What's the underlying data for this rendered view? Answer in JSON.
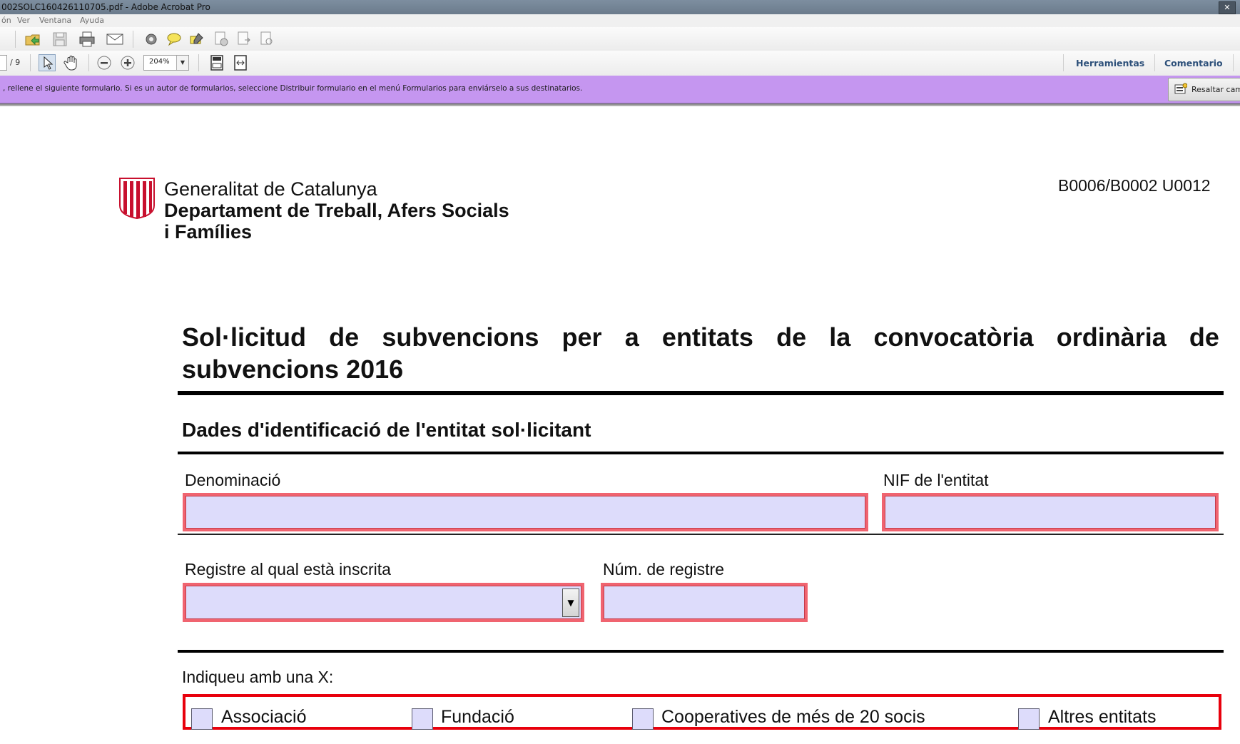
{
  "window": {
    "title": "002SOLC160426110705.pdf - Adobe Acrobat Pro"
  },
  "menu": {
    "items": [
      "ón",
      "Ver",
      "Ventana",
      "Ayuda"
    ]
  },
  "toolbar": {
    "page_total": "/ 9",
    "zoom": "204%",
    "tools_link": "Herramientas",
    "comment_link": "Comentario"
  },
  "form_bar": {
    "message": ", rellene el siguiente formulario. Si es un autor de formularios, seleccione Distribuir formulario en el menú Formularios para enviárselo a sus destinatarios.",
    "highlight_button": "Resaltar cam"
  },
  "document": {
    "org_line1": "Generalitat de Catalunya",
    "org_line2": "Departament de Treball, Afers Socials",
    "org_line3": "i Famílies",
    "reference": "B0006/B0002 U0012",
    "title_words_line1": [
      "Sol·licitud",
      "de",
      "subvencions",
      "per",
      "a",
      "entitats",
      "de",
      "la",
      "convocatòria",
      "ordinària",
      "de"
    ],
    "title_line2": "subvencions 2016",
    "section_title": "Dades d'identificació de l'entitat sol·licitant",
    "fields": {
      "denominacio_label": "Denominació",
      "nif_label": "NIF de l'entitat",
      "registre_label": "Registre al qual està inscrita",
      "num_registre_label": "Núm. de registre",
      "denominacio_value": "",
      "nif_value": "",
      "registre_value": "",
      "num_registre_value": ""
    },
    "indicate_label": "Indiqueu amb una X:",
    "entity_types": [
      "Associació",
      "Fundació",
      "Cooperatives de més de 20 socis",
      "Altres entitats"
    ],
    "colors": {
      "field_fill": "#dddcfb",
      "field_border": "#f06470",
      "group_border": "#e8000c",
      "form_bar": "#c596f0",
      "link": "#2c4f79"
    }
  }
}
